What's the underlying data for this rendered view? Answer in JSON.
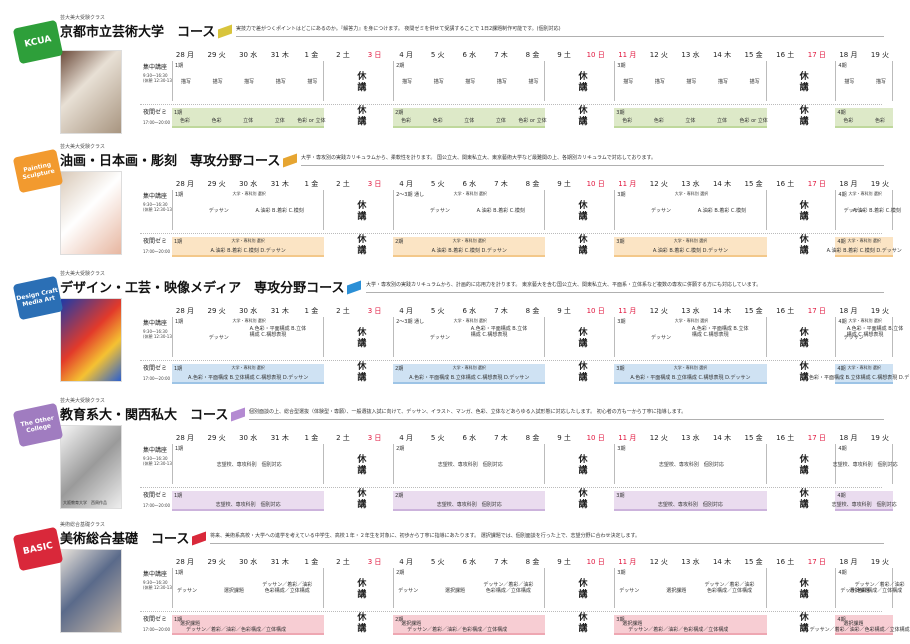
{
  "days": [
    "28 月",
    "29 火",
    "30 水",
    "31 木",
    "1 金",
    "2 土",
    "3 日",
    "4 月",
    "5 火",
    "6 水",
    "7 木",
    "8 金",
    "9 土",
    "10 日",
    "11 月",
    "12 火",
    "13 水",
    "14 木",
    "15 金",
    "16 土",
    "17 日",
    "18 月",
    "19 火"
  ],
  "red_days": [
    6,
    13,
    14,
    20
  ],
  "labels": {
    "intensive": "集中講座",
    "intensive_time": "9:30〜16:30",
    "intensive_note": "(休憩 12:30-13:30)",
    "evening": "夜間ゼミ",
    "evening_time": "17:00〜20:00",
    "closed": "休講",
    "closed1": "休",
    "closed2": "講"
  },
  "sections": [
    {
      "badge": "KCUA",
      "badge_color": "#2e9f3a",
      "sub": "芸大美大受験クラス",
      "title": "京都市立芸術大学　コース",
      "flag_color": "#d8c43c",
      "desc": "実技力で差がつくポイントはどこにあるのか。『解答力』を身につけます。 夜間ゼミを併せて受講することで 1日2課題制作可能です。(個別対応)",
      "ev_color": "#dde9c8",
      "line_color": "#bfd89c",
      "periods": [
        "1期",
        "2期",
        "3期",
        "4期"
      ],
      "day_cells": [
        "描写",
        "描写",
        "描写",
        "描写",
        "描写"
      ],
      "eve_cells": [
        "色彩",
        "色彩",
        "立体",
        "立体",
        "色彩 or 立体"
      ],
      "top_note": "",
      "eve_note": ""
    },
    {
      "badge": "Painting Sculpture",
      "badge_color": "#f29a2f",
      "sub": "芸大美大受験クラス",
      "title": "油画・日本画・彫刻　専攻分野コース",
      "flag_color": "#e6a531",
      "desc": "大学・専攻別の実践カリキュラムから、柔軟性を計ります。 国公立大、関東私立大、東京藝術大学など最難関の上、各期別カリキュラムで対応しております。",
      "ev_color": "#fbe4c4",
      "line_color": "#f3c88a",
      "periods": [
        "1期",
        "2〜3期 通し",
        "3期",
        "4期"
      ],
      "day_cells": [
        "デッサン",
        "A.油彩 B.着彩 C.模刻"
      ],
      "top_note": "大学・専科別 選択",
      "eve_note": "大学・専科別 選択",
      "eve_cells": [
        "A.油彩 B.着彩 C.模刻 D.デッサン"
      ]
    },
    {
      "badge": "Design Craft Media Art",
      "badge_color": "#2b6fb5",
      "sub": "芸大美大受験クラス",
      "title": "デザイン・工芸・映像メディア　専攻分野コース",
      "flag_color": "#2b8fd6",
      "desc": "大学・専攻別の実践カリキュラムから、計画的に応用力を計ります。 東京藝大を含む国公立大、関東私立大、平面系・立体系など複数の専攻に併願する方にも対応しています。",
      "ev_color": "#cfe2f3",
      "line_color": "#9dc4e6",
      "periods": [
        "1期",
        "2〜3期 通し",
        "3期",
        "4期"
      ],
      "day_cells": [
        "デッサン",
        "A.色彩・平面構成 B.立体構成 C.構想表現"
      ],
      "top_note": "大学・専科別 選択",
      "eve_note": "大学・専科別 選択",
      "eve_cells": [
        "A.色彩・平面構成 B.立体構成 C.構想表現 D.デッサン"
      ]
    },
    {
      "badge": "The Other College",
      "badge_color": "#a07cc0",
      "sub": "芸大美大受験クラス",
      "title": "教育系大・関西私大　コース",
      "flag_color": "#b48ad2",
      "desc": "個別面談の上、総合型選抜（体験型・専願）、一般選抜入試に向けて、デッサン、イラスト、マンガ、色彩、立体などあらゆる入試形態に対応したします。 初心者の方も一から丁寧に指導します。",
      "ev_color": "#eadcef",
      "line_color": "#ccb3dc",
      "periods": [
        "1期",
        "2期",
        "3期",
        "4期"
      ],
      "day_cells": [
        "志望校、専攻科別　個別対応"
      ],
      "eve_cells": [
        "志望校、専攻科別　個別対応"
      ],
      "top_note": "",
      "eve_note": "",
      "caption": "大阪教育大学　西周作品"
    },
    {
      "badge": "BASIC",
      "badge_color": "#d9283a",
      "sub": "美術総合基礎クラス",
      "title": "美術総合基礎　コース",
      "flag_color": "#d9283a",
      "desc": "将来、美術系高校・大学への進学を考えている中学生、高校１年・２年生を対象に、初歩から丁寧に指導にあたります。 選択課題では、個別面談を行った上で、志望分野に合わせ決定します。",
      "ev_color": "#f7cdd3",
      "line_color": "#eea7b2",
      "periods": [
        "1期",
        "2期",
        "3期",
        "4期"
      ],
      "day_cells": [
        "デッサン",
        "選択課題",
        "デッサン／着彩／油彩 色彩構成／立体構成"
      ],
      "eve_cells": [
        "選択課題",
        "デッサン／着彩／油彩／色彩構成／立体構成"
      ],
      "top_note": "",
      "eve_note": ""
    }
  ]
}
